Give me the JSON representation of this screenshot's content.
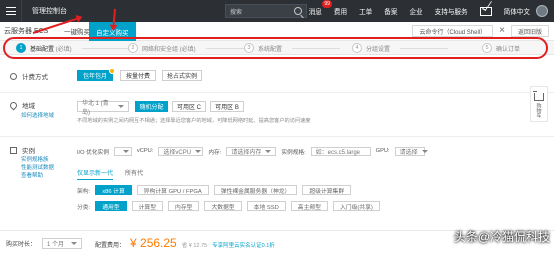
{
  "topbar": {
    "title": "管理控制台",
    "search_placeholder": "搜索",
    "nav": [
      {
        "label": "消息",
        "badge": "99"
      },
      {
        "label": "费用"
      },
      {
        "label": "工单"
      },
      {
        "label": "备案"
      },
      {
        "label": "企业"
      },
      {
        "label": "支持与服务"
      },
      {
        "label": "简体中文"
      }
    ]
  },
  "subbar": {
    "product": "云服务器 ECS",
    "tab_one_click": "一键购买",
    "tab_custom": "自定义购买",
    "region_label": "云命令行（Cloud Shell）",
    "close_symbol": "×",
    "quick_link": "返回旧版"
  },
  "steps": [
    {
      "index": "1",
      "label": "基础配置",
      "suffix": "(必填)"
    },
    {
      "index": "2",
      "label": "网络和安全组",
      "suffix": "(必填)"
    },
    {
      "index": "3",
      "label": "系统配置",
      "suffix": ""
    },
    {
      "index": "4",
      "label": "分组设置",
      "suffix": ""
    },
    {
      "index": "5",
      "label": "确认订单",
      "suffix": ""
    }
  ],
  "billing": {
    "label": "计费方式",
    "options": [
      "包年包月",
      "按量付费",
      "抢占式实例"
    ]
  },
  "region": {
    "label": "地域",
    "help": "如何选择地域",
    "selected": "华北 1 (青岛)",
    "zones": [
      "随机分配",
      "可用区 C",
      "可用区 B"
    ],
    "note": "不同地域的实例之间内网互不相通；选择靠近您客户的地域，可降低网络时延、提高您客户的访问速度"
  },
  "instance": {
    "label": "实例",
    "links": [
      "实例规格族",
      "性能测试数据",
      "查看帮助"
    ],
    "filters": {
      "io_optimized_label": "I/O 优化实例",
      "vcpu_label": "vCPU:",
      "vcpu_value": "选择vCPU",
      "mem_label": "内存:",
      "mem_value": "请选择内存",
      "spec_name_label": "实例规格:",
      "spec_name_placeholder": "如：ecs.c5.large",
      "gpu_label": "GPU:",
      "gpu_value": "请选择"
    },
    "tabs": [
      "仅显示新一代",
      "所有代"
    ],
    "arch_label": "架构:",
    "arch_options": [
      "x86 计算",
      "异构计算 GPU / FPGA",
      "弹性裸金属服务器（神龙）",
      "超级计算集群"
    ],
    "category_label": "分类:",
    "category_options": [
      "通用型",
      "计算型",
      "内存型",
      "大数据型",
      "本地 SSD",
      "高主频型",
      "入门级(共享)"
    ]
  },
  "bottom": {
    "duration_label": "购买时长：",
    "duration_value": "1 个月",
    "price_label": "配置费用：",
    "price_amount": "¥ 256.25",
    "price_sub": "省 ¥ 12.75",
    "promo": "专享阿里云实名认证0.1折"
  },
  "sidecart": {
    "text": "购物车"
  },
  "watermark": "头条@冷猫侃科技",
  "colors": {
    "accent": "#00a2ca",
    "orange": "#ff7a00",
    "red": "#e02020",
    "topbar": "#2c3034"
  }
}
